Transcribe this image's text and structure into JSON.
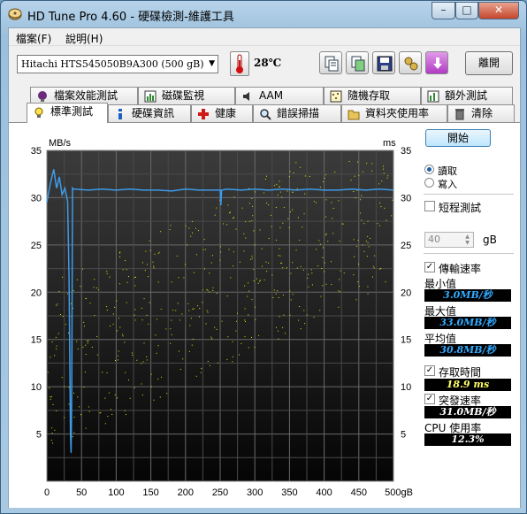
{
  "window": {
    "title": "HD Tune Pro 4.60 - 硬碟檢測-維護工具",
    "minimize": "–",
    "maximize": "□",
    "close": "✕"
  },
  "menu": {
    "file": "檔案(F)",
    "help": "說明(H)"
  },
  "toolbar": {
    "drive": "Hitachi HTS545050B9A300  (500 gB)",
    "temperature": "28℃",
    "exit": "離開",
    "icons": [
      "copy-text-icon",
      "copy-screenshot-icon",
      "save-icon",
      "options-icon",
      "download-icon"
    ]
  },
  "tabs_top": [
    {
      "label": "檔案效能測試",
      "icon": "file-benchmark-icon"
    },
    {
      "label": "磁碟監視",
      "icon": "disk-monitor-icon"
    },
    {
      "label": "AAM",
      "icon": "speaker-icon"
    },
    {
      "label": "隨機存取",
      "icon": "random-access-icon"
    },
    {
      "label": "額外測試",
      "icon": "extra-tests-icon"
    }
  ],
  "tabs_bottom": [
    {
      "label": "標準測試",
      "icon": "benchmark-bulb-icon"
    },
    {
      "label": "硬碟資訊",
      "icon": "info-icon"
    },
    {
      "label": "健康",
      "icon": "health-cross-icon"
    },
    {
      "label": "錯誤掃描",
      "icon": "magnifier-icon"
    },
    {
      "label": "資料夾使用率",
      "icon": "folder-icon"
    },
    {
      "label": "清除",
      "icon": "trash-icon"
    }
  ],
  "side": {
    "start": "開始",
    "read": "讀取",
    "write": "寫入",
    "short_test": "短程測試",
    "short_value": "40",
    "unit": "gB",
    "transfer_rate": "傳輸速率",
    "min_label": "最小值",
    "min_value": "3.0MB/秒",
    "max_label": "最大值",
    "max_value": "33.0MB/秒",
    "avg_label": "平均值",
    "avg_value": "30.8MB/秒",
    "access_time": "存取時間",
    "access_value": "18.9 ms",
    "burst_rate": "突發速率",
    "burst_value": "31.0MB/秒",
    "cpu_label": "CPU 使用率",
    "cpu_value": "12.3%"
  },
  "chart_data": {
    "type": "line",
    "left_unit": "MB/s",
    "right_unit": "ms",
    "x_unit": "gB",
    "xlim": [
      0,
      500
    ],
    "ylim": [
      0,
      35
    ],
    "x_ticks": [
      0,
      50,
      100,
      150,
      200,
      250,
      300,
      350,
      400,
      450,
      500
    ],
    "y_ticks": [
      5,
      10,
      15,
      20,
      25,
      30,
      35
    ],
    "grid": true,
    "series": [
      {
        "name": "",
        "color": "#3d9be9",
        "x": [
          0,
          5,
          10,
          14,
          18,
          22,
          26,
          30,
          32,
          34,
          35,
          36,
          37,
          38,
          40,
          60,
          80,
          100,
          120,
          140,
          160,
          180,
          200,
          220,
          240,
          250,
          251,
          252,
          260,
          280,
          300,
          320,
          340,
          360,
          380,
          400,
          420,
          440,
          460,
          480,
          500
        ],
        "y": [
          29.5,
          31.5,
          33.0,
          31.0,
          32.2,
          30.3,
          31.0,
          29.6,
          21.5,
          5.0,
          3.0,
          10.5,
          31.0,
          30.9,
          30.9,
          30.8,
          30.9,
          30.8,
          30.9,
          30.8,
          30.8,
          30.7,
          30.9,
          30.8,
          30.8,
          30.8,
          29.2,
          30.8,
          30.9,
          30.8,
          30.9,
          30.8,
          30.9,
          30.8,
          30.9,
          30.8,
          30.8,
          30.9,
          30.8,
          30.9,
          30.8
        ]
      }
    ],
    "access_points_color": "#e8e800"
  }
}
